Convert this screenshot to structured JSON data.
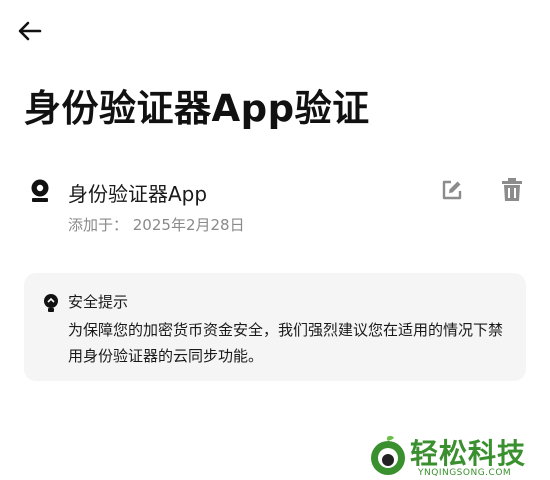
{
  "header": {
    "back_icon": "arrow-left-icon",
    "title": "身份验证器App验证"
  },
  "authenticator": {
    "icon": "authenticator-icon",
    "name": "身份验证器App",
    "added_date": "添加于：  2025年2月28日",
    "edit_icon": "edit-icon",
    "delete_icon": "trash-icon"
  },
  "notice": {
    "icon": "bulb-icon",
    "title": "安全提示",
    "body": "为保障您的加密货币资金安全，我们强烈建议您在适用的情况下禁用身份验证器的云同步功能。"
  },
  "watermark": {
    "text": "轻松科技",
    "subtext": "YNQINGSONG.COM"
  },
  "colors": {
    "icon_gray": "#8c8c8c",
    "notice_bg": "#f5f5f5",
    "watermark_green": "#3a8f2e"
  }
}
